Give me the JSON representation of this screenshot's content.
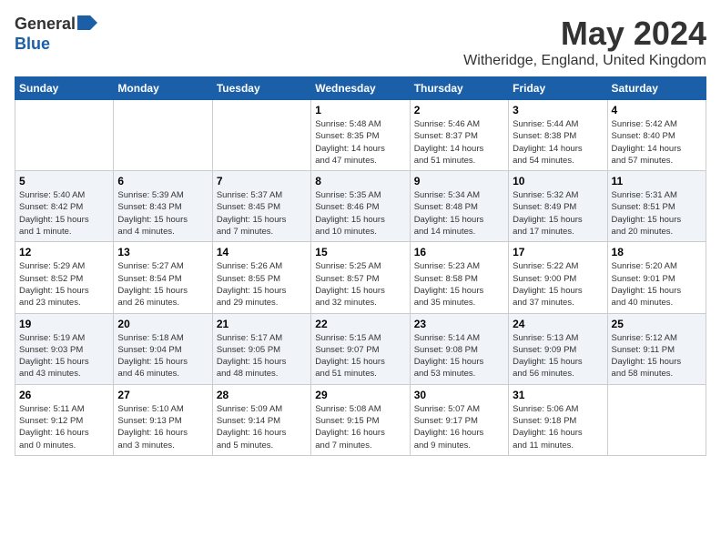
{
  "header": {
    "logo_general": "General",
    "logo_blue": "Blue",
    "month_title": "May 2024",
    "location": "Witheridge, England, United Kingdom"
  },
  "days_of_week": [
    "Sunday",
    "Monday",
    "Tuesday",
    "Wednesday",
    "Thursday",
    "Friday",
    "Saturday"
  ],
  "weeks": [
    [
      {
        "day": "",
        "info": ""
      },
      {
        "day": "",
        "info": ""
      },
      {
        "day": "",
        "info": ""
      },
      {
        "day": "1",
        "info": "Sunrise: 5:48 AM\nSunset: 8:35 PM\nDaylight: 14 hours\nand 47 minutes."
      },
      {
        "day": "2",
        "info": "Sunrise: 5:46 AM\nSunset: 8:37 PM\nDaylight: 14 hours\nand 51 minutes."
      },
      {
        "day": "3",
        "info": "Sunrise: 5:44 AM\nSunset: 8:38 PM\nDaylight: 14 hours\nand 54 minutes."
      },
      {
        "day": "4",
        "info": "Sunrise: 5:42 AM\nSunset: 8:40 PM\nDaylight: 14 hours\nand 57 minutes."
      }
    ],
    [
      {
        "day": "5",
        "info": "Sunrise: 5:40 AM\nSunset: 8:42 PM\nDaylight: 15 hours\nand 1 minute."
      },
      {
        "day": "6",
        "info": "Sunrise: 5:39 AM\nSunset: 8:43 PM\nDaylight: 15 hours\nand 4 minutes."
      },
      {
        "day": "7",
        "info": "Sunrise: 5:37 AM\nSunset: 8:45 PM\nDaylight: 15 hours\nand 7 minutes."
      },
      {
        "day": "8",
        "info": "Sunrise: 5:35 AM\nSunset: 8:46 PM\nDaylight: 15 hours\nand 10 minutes."
      },
      {
        "day": "9",
        "info": "Sunrise: 5:34 AM\nSunset: 8:48 PM\nDaylight: 15 hours\nand 14 minutes."
      },
      {
        "day": "10",
        "info": "Sunrise: 5:32 AM\nSunset: 8:49 PM\nDaylight: 15 hours\nand 17 minutes."
      },
      {
        "day": "11",
        "info": "Sunrise: 5:31 AM\nSunset: 8:51 PM\nDaylight: 15 hours\nand 20 minutes."
      }
    ],
    [
      {
        "day": "12",
        "info": "Sunrise: 5:29 AM\nSunset: 8:52 PM\nDaylight: 15 hours\nand 23 minutes."
      },
      {
        "day": "13",
        "info": "Sunrise: 5:27 AM\nSunset: 8:54 PM\nDaylight: 15 hours\nand 26 minutes."
      },
      {
        "day": "14",
        "info": "Sunrise: 5:26 AM\nSunset: 8:55 PM\nDaylight: 15 hours\nand 29 minutes."
      },
      {
        "day": "15",
        "info": "Sunrise: 5:25 AM\nSunset: 8:57 PM\nDaylight: 15 hours\nand 32 minutes."
      },
      {
        "day": "16",
        "info": "Sunrise: 5:23 AM\nSunset: 8:58 PM\nDaylight: 15 hours\nand 35 minutes."
      },
      {
        "day": "17",
        "info": "Sunrise: 5:22 AM\nSunset: 9:00 PM\nDaylight: 15 hours\nand 37 minutes."
      },
      {
        "day": "18",
        "info": "Sunrise: 5:20 AM\nSunset: 9:01 PM\nDaylight: 15 hours\nand 40 minutes."
      }
    ],
    [
      {
        "day": "19",
        "info": "Sunrise: 5:19 AM\nSunset: 9:03 PM\nDaylight: 15 hours\nand 43 minutes."
      },
      {
        "day": "20",
        "info": "Sunrise: 5:18 AM\nSunset: 9:04 PM\nDaylight: 15 hours\nand 46 minutes."
      },
      {
        "day": "21",
        "info": "Sunrise: 5:17 AM\nSunset: 9:05 PM\nDaylight: 15 hours\nand 48 minutes."
      },
      {
        "day": "22",
        "info": "Sunrise: 5:15 AM\nSunset: 9:07 PM\nDaylight: 15 hours\nand 51 minutes."
      },
      {
        "day": "23",
        "info": "Sunrise: 5:14 AM\nSunset: 9:08 PM\nDaylight: 15 hours\nand 53 minutes."
      },
      {
        "day": "24",
        "info": "Sunrise: 5:13 AM\nSunset: 9:09 PM\nDaylight: 15 hours\nand 56 minutes."
      },
      {
        "day": "25",
        "info": "Sunrise: 5:12 AM\nSunset: 9:11 PM\nDaylight: 15 hours\nand 58 minutes."
      }
    ],
    [
      {
        "day": "26",
        "info": "Sunrise: 5:11 AM\nSunset: 9:12 PM\nDaylight: 16 hours\nand 0 minutes."
      },
      {
        "day": "27",
        "info": "Sunrise: 5:10 AM\nSunset: 9:13 PM\nDaylight: 16 hours\nand 3 minutes."
      },
      {
        "day": "28",
        "info": "Sunrise: 5:09 AM\nSunset: 9:14 PM\nDaylight: 16 hours\nand 5 minutes."
      },
      {
        "day": "29",
        "info": "Sunrise: 5:08 AM\nSunset: 9:15 PM\nDaylight: 16 hours\nand 7 minutes."
      },
      {
        "day": "30",
        "info": "Sunrise: 5:07 AM\nSunset: 9:17 PM\nDaylight: 16 hours\nand 9 minutes."
      },
      {
        "day": "31",
        "info": "Sunrise: 5:06 AM\nSunset: 9:18 PM\nDaylight: 16 hours\nand 11 minutes."
      },
      {
        "day": "",
        "info": ""
      }
    ]
  ]
}
